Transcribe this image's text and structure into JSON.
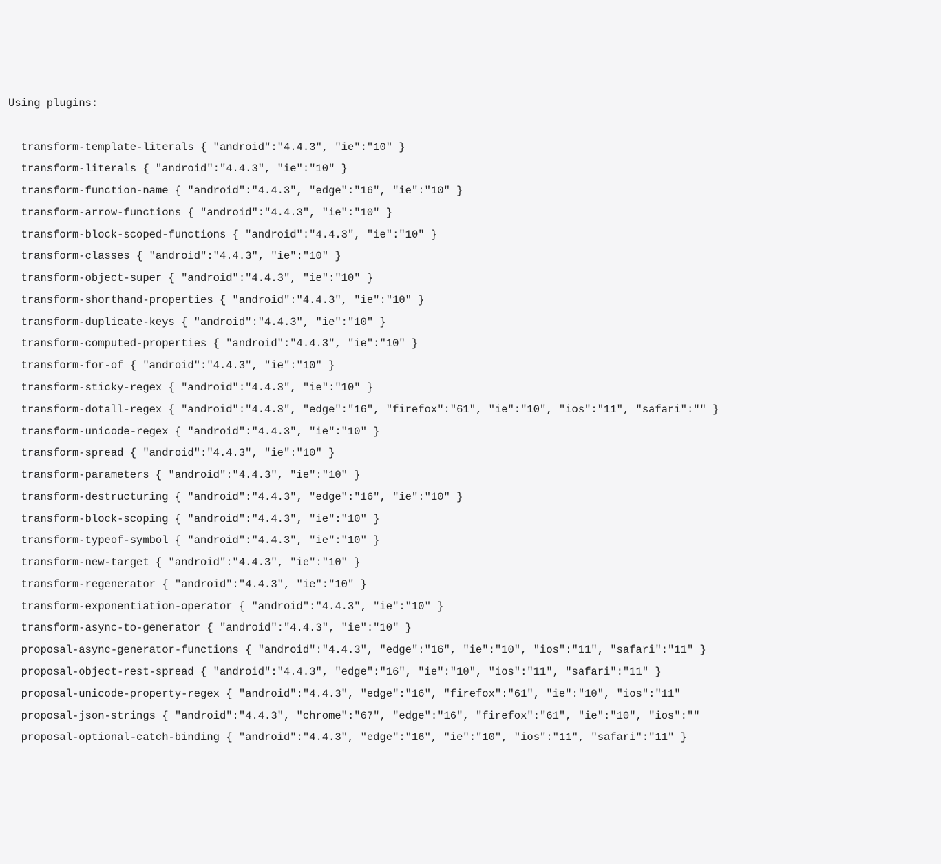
{
  "header": "Using plugins:",
  "plugins": [
    {
      "name": "transform-template-literals",
      "targets": {
        "android": "4.4.3",
        "ie": "10"
      }
    },
    {
      "name": "transform-literals",
      "targets": {
        "android": "4.4.3",
        "ie": "10"
      }
    },
    {
      "name": "transform-function-name",
      "targets": {
        "android": "4.4.3",
        "edge": "16",
        "ie": "10"
      }
    },
    {
      "name": "transform-arrow-functions",
      "targets": {
        "android": "4.4.3",
        "ie": "10"
      }
    },
    {
      "name": "transform-block-scoped-functions",
      "targets": {
        "android": "4.4.3",
        "ie": "10"
      }
    },
    {
      "name": "transform-classes",
      "targets": {
        "android": "4.4.3",
        "ie": "10"
      }
    },
    {
      "name": "transform-object-super",
      "targets": {
        "android": "4.4.3",
        "ie": "10"
      }
    },
    {
      "name": "transform-shorthand-properties",
      "targets": {
        "android": "4.4.3",
        "ie": "10"
      }
    },
    {
      "name": "transform-duplicate-keys",
      "targets": {
        "android": "4.4.3",
        "ie": "10"
      }
    },
    {
      "name": "transform-computed-properties",
      "targets": {
        "android": "4.4.3",
        "ie": "10"
      }
    },
    {
      "name": "transform-for-of",
      "targets": {
        "android": "4.4.3",
        "ie": "10"
      }
    },
    {
      "name": "transform-sticky-regex",
      "targets": {
        "android": "4.4.3",
        "ie": "10"
      }
    },
    {
      "name": "transform-dotall-regex",
      "targets": {
        "android": "4.4.3",
        "edge": "16",
        "firefox": "61",
        "ie": "10",
        "ios": "11",
        "safari": ""
      }
    },
    {
      "name": "transform-unicode-regex",
      "targets": {
        "android": "4.4.3",
        "ie": "10"
      }
    },
    {
      "name": "transform-spread",
      "targets": {
        "android": "4.4.3",
        "ie": "10"
      }
    },
    {
      "name": "transform-parameters",
      "targets": {
        "android": "4.4.3",
        "ie": "10"
      }
    },
    {
      "name": "transform-destructuring",
      "targets": {
        "android": "4.4.3",
        "edge": "16",
        "ie": "10"
      }
    },
    {
      "name": "transform-block-scoping",
      "targets": {
        "android": "4.4.3",
        "ie": "10"
      }
    },
    {
      "name": "transform-typeof-symbol",
      "targets": {
        "android": "4.4.3",
        "ie": "10"
      }
    },
    {
      "name": "transform-new-target",
      "targets": {
        "android": "4.4.3",
        "ie": "10"
      }
    },
    {
      "name": "transform-regenerator",
      "targets": {
        "android": "4.4.3",
        "ie": "10"
      }
    },
    {
      "name": "transform-exponentiation-operator",
      "targets": {
        "android": "4.4.3",
        "ie": "10"
      }
    },
    {
      "name": "transform-async-to-generator",
      "targets": {
        "android": "4.4.3",
        "ie": "10"
      }
    },
    {
      "name": "proposal-async-generator-functions",
      "targets": {
        "android": "4.4.3",
        "edge": "16",
        "ie": "10",
        "ios": "11",
        "safari": "11"
      }
    },
    {
      "name": "proposal-object-rest-spread",
      "targets": {
        "android": "4.4.3",
        "edge": "16",
        "ie": "10",
        "ios": "11",
        "safari": "11"
      }
    },
    {
      "name": "proposal-unicode-property-regex",
      "targets": {
        "android": "4.4.3",
        "edge": "16",
        "firefox": "61",
        "ie": "10",
        "ios": "11"
      },
      "truncated": true
    },
    {
      "name": "proposal-json-strings",
      "targets": {
        "android": "4.4.3",
        "chrome": "67",
        "edge": "16",
        "firefox": "61",
        "ie": "10",
        "ios": ""
      },
      "truncated": true
    },
    {
      "name": "proposal-optional-catch-binding",
      "targets": {
        "android": "4.4.3",
        "edge": "16",
        "ie": "10",
        "ios": "11",
        "safari": "11"
      }
    }
  ]
}
